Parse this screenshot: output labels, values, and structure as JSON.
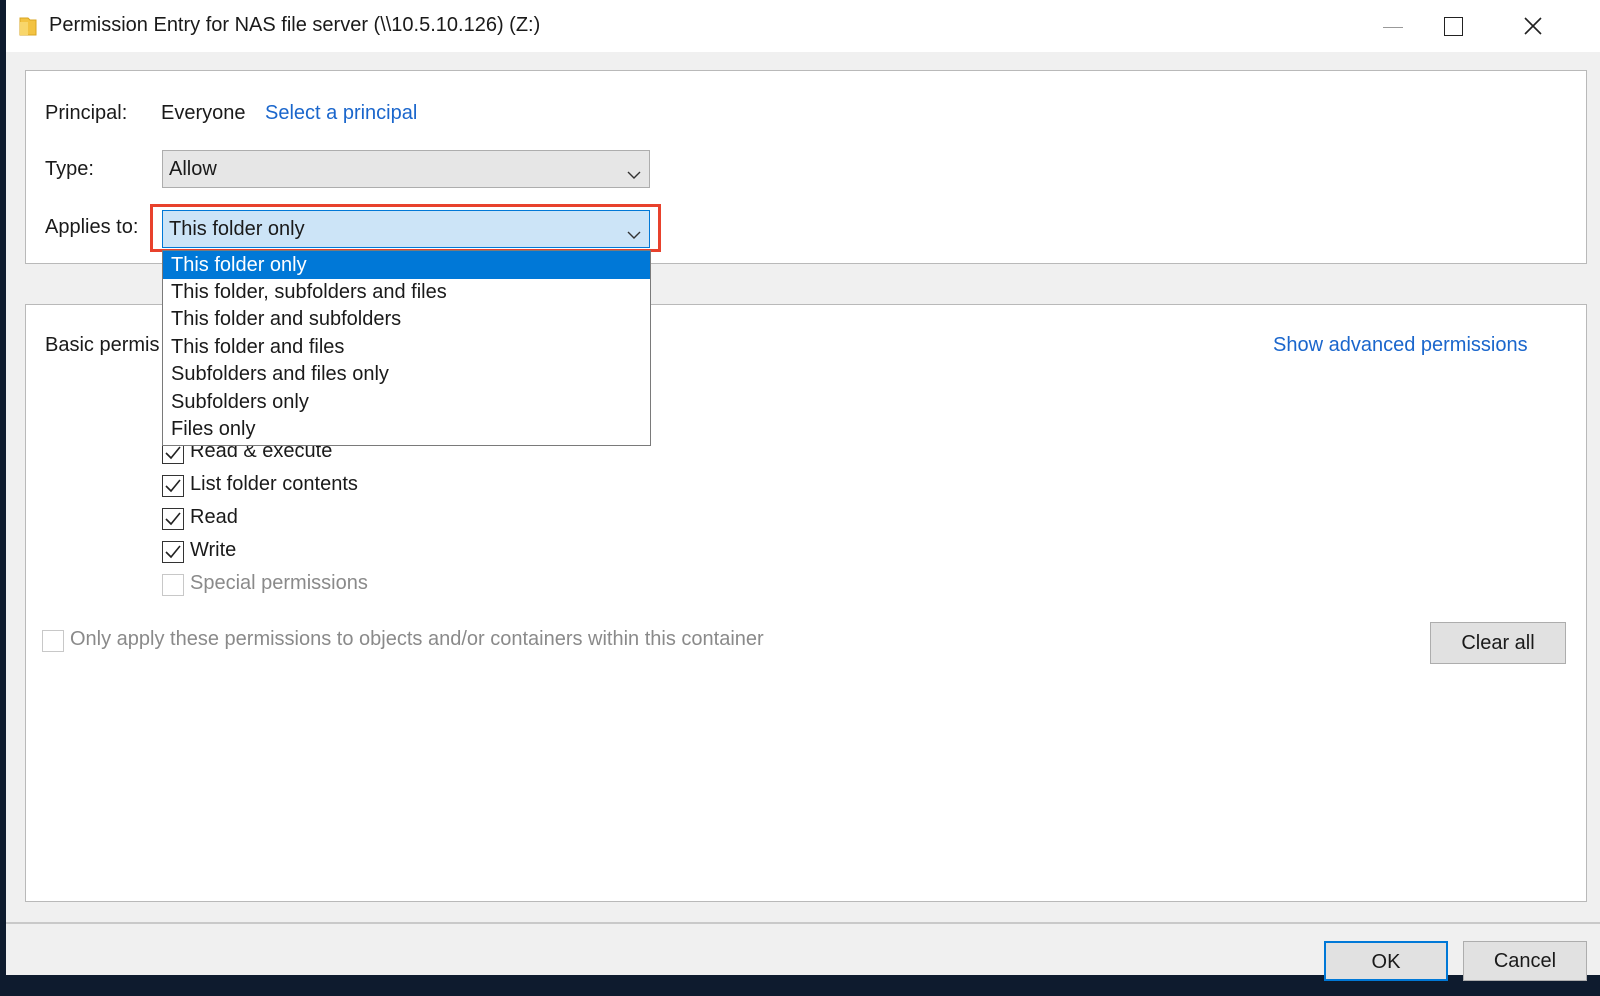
{
  "window": {
    "title": "Permission Entry for NAS file server (\\\\10.5.10.126) (Z:)",
    "icon": "folder-icon",
    "controls": [
      "minimize-icon",
      "maximize-icon",
      "close-icon"
    ]
  },
  "principal": {
    "label": "Principal:",
    "value": "Everyone",
    "link": "Select a principal"
  },
  "type": {
    "label": "Type:",
    "value": "Allow"
  },
  "applies_to": {
    "label": "Applies to:",
    "value": "This folder only",
    "options": [
      "This folder only",
      "This folder, subfolders and files",
      "This folder and subfolders",
      "This folder and files",
      "Subfolders and files only",
      "Subfolders only",
      "Files only"
    ],
    "selected_index": 0
  },
  "basic_permissions": {
    "label": "Basic permis",
    "advanced_link": "Show advanced permissions",
    "items": [
      {
        "label": "Read & execute",
        "checked": true,
        "enabled": true
      },
      {
        "label": "List folder contents",
        "checked": true,
        "enabled": true
      },
      {
        "label": "Read",
        "checked": true,
        "enabled": true
      },
      {
        "label": "Write",
        "checked": true,
        "enabled": true
      },
      {
        "label": "Special permissions",
        "checked": false,
        "enabled": false
      }
    ]
  },
  "only_apply": {
    "label": "Only apply these permissions to objects and/or containers within this container",
    "checked": false,
    "enabled": false
  },
  "buttons": {
    "clear_all": "Clear all",
    "ok": "OK",
    "cancel": "Cancel"
  },
  "colors": {
    "accent": "#0078d7",
    "link": "#1a66cc",
    "highlight": "#e8412c"
  }
}
